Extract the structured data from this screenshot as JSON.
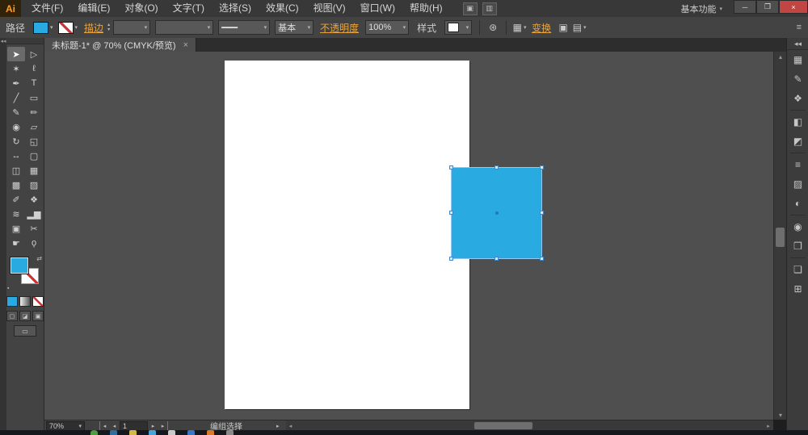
{
  "colors": {
    "fill_blue": "#29abe2",
    "link_orange": "#e8a33d",
    "close_red": "#c04543"
  },
  "menubar": {
    "logo_text": "Ai",
    "items": [
      "文件(F)",
      "编辑(E)",
      "对象(O)",
      "文字(T)",
      "选择(S)",
      "效果(C)",
      "视图(V)",
      "窗口(W)",
      "帮助(H)"
    ],
    "icons": [
      {
        "name": "arrange-documents-icon",
        "glyph": "▣"
      },
      {
        "name": "document-layout-icon",
        "glyph": "▥"
      }
    ],
    "workspace_label": "基本功能",
    "dropdown_glyph": "▾",
    "window_controls": [
      {
        "name": "minimize-button",
        "glyph": "─"
      },
      {
        "name": "restore-button",
        "glyph": "❐"
      },
      {
        "name": "close-button",
        "glyph": "×"
      }
    ]
  },
  "controlbar": {
    "target_label": "路径",
    "stroke_link_label": "描边",
    "stroke_width_value": "",
    "width_profile_value": "",
    "brush_preview_glyph": "━━━",
    "brush_name": "基本",
    "opacity_link_label": "不透明度",
    "opacity_value": "100%",
    "style_label": "样式",
    "recolor_icon_glyph": "⊛",
    "align_icon_glyph": "▦",
    "transform_link_label": "变换",
    "isolate_icon_glyph": "▣",
    "select_similar_glyph": "▤",
    "panel_menu_glyph": "≡",
    "dropdown_glyph": "▾",
    "stepper_up": "▴",
    "stepper_down": "▾"
  },
  "document_tab": {
    "title": "未标题-1* @ 70% (CMYK/预览)",
    "close_glyph": "×"
  },
  "toolbar": {
    "collapse_glyph": "◂◂",
    "tools": [
      {
        "name": "selection-tool",
        "glyph": "➤",
        "selected": true
      },
      {
        "name": "direct-selection-tool",
        "glyph": "▷"
      },
      {
        "name": "magic-wand-tool",
        "glyph": "✶"
      },
      {
        "name": "lasso-tool",
        "glyph": "ℓ"
      },
      {
        "name": "pen-tool",
        "glyph": "✒"
      },
      {
        "name": "type-tool",
        "glyph": "T"
      },
      {
        "name": "line-segment-tool",
        "glyph": "╱"
      },
      {
        "name": "rectangle-tool",
        "glyph": "▭"
      },
      {
        "name": "paintbrush-tool",
        "glyph": "✎"
      },
      {
        "name": "pencil-tool",
        "glyph": "✏"
      },
      {
        "name": "blob-brush-tool",
        "glyph": "◉"
      },
      {
        "name": "eraser-tool",
        "glyph": "▱"
      },
      {
        "name": "rotate-tool",
        "glyph": "↻"
      },
      {
        "name": "scale-tool",
        "glyph": "◱"
      },
      {
        "name": "width-tool",
        "glyph": "↔"
      },
      {
        "name": "free-transform-tool",
        "glyph": "▢"
      },
      {
        "name": "shape-builder-tool",
        "glyph": "◫"
      },
      {
        "name": "perspective-grid-tool",
        "glyph": "▦"
      },
      {
        "name": "mesh-tool",
        "glyph": "▩"
      },
      {
        "name": "gradient-tool",
        "glyph": "▨"
      },
      {
        "name": "eyedropper-tool",
        "glyph": "✐"
      },
      {
        "name": "blend-tool",
        "glyph": "❖"
      },
      {
        "name": "symbol-sprayer-tool",
        "glyph": "≋"
      },
      {
        "name": "column-graph-tool",
        "glyph": "▂▆"
      },
      {
        "name": "artboard-tool",
        "glyph": "▣"
      },
      {
        "name": "slice-tool",
        "glyph": "✂"
      },
      {
        "name": "hand-tool",
        "glyph": "☛"
      },
      {
        "name": "zoom-tool",
        "glyph": "ϙ"
      }
    ],
    "swap_glyph": "⇄",
    "default_glyph": "▪",
    "draw_mode_buttons": [
      {
        "name": "draw-normal-button",
        "glyph": "▢"
      },
      {
        "name": "draw-behind-button",
        "glyph": "◪"
      },
      {
        "name": "draw-inside-button",
        "glyph": "▣"
      }
    ],
    "screen_mode_glyph": "▭"
  },
  "canvas": {
    "objects": [
      {
        "type": "rectangle",
        "fill": "#29abe2",
        "selected": true
      }
    ]
  },
  "right_dock": {
    "expand_glyph": "◂◂",
    "icons": [
      {
        "name": "swatches-panel-icon",
        "glyph": "▦"
      },
      {
        "name": "brushes-panel-icon",
        "glyph": "✎"
      },
      {
        "name": "symbols-panel-icon",
        "glyph": "❖"
      },
      {
        "sep": true
      },
      {
        "name": "color-panel-icon",
        "glyph": "◧"
      },
      {
        "name": "color-guide-panel-icon",
        "glyph": "◩"
      },
      {
        "sep": true
      },
      {
        "name": "stroke-panel-icon",
        "glyph": "≡"
      },
      {
        "name": "gradient-panel-icon",
        "glyph": "▨"
      },
      {
        "name": "transparency-panel-icon",
        "glyph": "◐"
      },
      {
        "sep": true
      },
      {
        "name": "appearance-panel-icon",
        "glyph": "◉"
      },
      {
        "name": "graphic-styles-panel-icon",
        "glyph": "❒"
      },
      {
        "sep": true
      },
      {
        "name": "layers-panel-icon",
        "glyph": "❏"
      },
      {
        "name": "artboards-panel-icon",
        "glyph": "⊞"
      }
    ]
  },
  "statusbar": {
    "zoom_value": "70%",
    "nav_first": "◂",
    "nav_prev": "◂",
    "artboard_field": "1",
    "nav_next": "▸",
    "nav_last": "▸",
    "tool_status": "编组选择",
    "flyout_glyph": "▸",
    "hscroll_left": "◂",
    "hscroll_right": "▸",
    "vscroll_up": "▴",
    "vscroll_down": "▾",
    "dropdown_glyph": "▾"
  },
  "taskbar": {
    "icons": [
      {
        "name": "start-button",
        "color": "#4a9e3f",
        "round": true
      },
      {
        "name": "taskbar-app-icon-1",
        "color": "#2f6f9f"
      },
      {
        "name": "taskbar-app-icon-2",
        "color": "#d8b74a"
      },
      {
        "name": "taskbar-app-icon-3",
        "color": "#4aa3d8"
      },
      {
        "name": "taskbar-app-icon-4",
        "color": "#c9c9c9"
      },
      {
        "name": "taskbar-app-icon-5",
        "color": "#3a78c2"
      },
      {
        "name": "taskbar-app-icon-6",
        "color": "#d87b2a"
      },
      {
        "name": "taskbar-app-icon-7",
        "color": "#8a8a8a"
      }
    ]
  }
}
